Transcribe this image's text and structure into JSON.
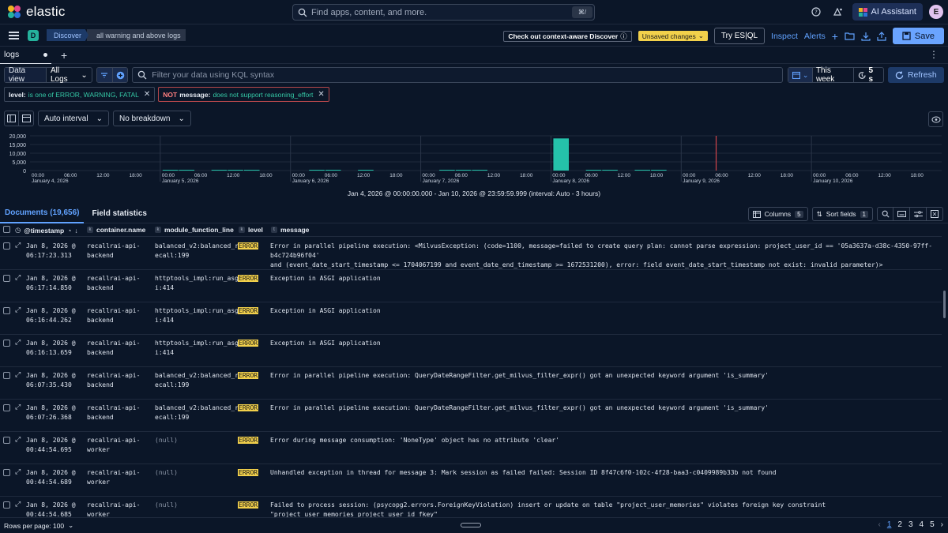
{
  "header": {
    "brand": "elastic",
    "search_placeholder": "Find apps, content, and more.",
    "search_shortcut": "⌘/",
    "ai_assistant_label": "AI Assistant",
    "avatar_initial": "E"
  },
  "navbar": {
    "space_initial": "D",
    "breadcrumb_app": "Discover",
    "breadcrumb_page": "all warning and above logs",
    "context_aware_label": "Check out context-aware Discover",
    "unsaved_label": "Unsaved changes",
    "esql_label": "Try ES|QL",
    "inspect_label": "Inspect",
    "alerts_label": "Alerts",
    "save_label": "Save"
  },
  "tabs": [
    {
      "label": "logs"
    }
  ],
  "query": {
    "data_view_label": "Data view",
    "data_view_value": "All Logs",
    "kql_placeholder": "Filter your data using KQL syntax",
    "date_range": "This week",
    "refresh_interval": "5 s",
    "refresh_label": "Refresh"
  },
  "filters": [
    {
      "key": "level:",
      "value": "is one of ERROR, WARNING, FATAL",
      "negated": false
    },
    {
      "not": "NOT",
      "key": "message:",
      "value": "does not support reasoning_effort",
      "negated": true
    }
  ],
  "chart_tools": {
    "interval_label": "Auto interval",
    "breakdown_label": "No breakdown"
  },
  "chart_data": {
    "type": "bar",
    "y_ticks": [
      "20,000",
      "15,000",
      "10,000",
      "5,000",
      "0"
    ],
    "ylim": [
      0,
      20000
    ],
    "days": [
      "January 4, 2026",
      "January 5, 2026",
      "January 6, 2026",
      "January 7, 2026",
      "January 8, 2026",
      "January 9, 2026",
      "January 10, 2026"
    ],
    "hour_ticks": [
      "00:00",
      "06:00",
      "12:00",
      "18:00"
    ],
    "bars": [
      {
        "bucket": "Jan 5, 00:00",
        "value": 150
      },
      {
        "bucket": "Jan 5, 03:00",
        "value": 180
      },
      {
        "bucket": "Jan 5, 09:00",
        "value": 120
      },
      {
        "bucket": "Jan 5, 12:00",
        "value": 80
      },
      {
        "bucket": "Jan 5, 15:00",
        "value": 100
      },
      {
        "bucket": "Jan 6, 03:00",
        "value": 200
      },
      {
        "bucket": "Jan 6, 06:00",
        "value": 100
      },
      {
        "bucket": "Jan 6, 12:00",
        "value": 120
      },
      {
        "bucket": "Jan 7, 03:00",
        "value": 150
      },
      {
        "bucket": "Jan 7, 06:00",
        "value": 200
      },
      {
        "bucket": "Jan 7, 09:00",
        "value": 80
      },
      {
        "bucket": "Jan 8, 00:00",
        "value": 18500
      },
      {
        "bucket": "Jan 8, 06:00",
        "value": 150
      },
      {
        "bucket": "Jan 8, 09:00",
        "value": 120
      },
      {
        "bucket": "Jan 8, 15:00",
        "value": 250
      },
      {
        "bucket": "Jan 8, 18:00",
        "value": 200
      }
    ],
    "now_marker": "Jan 9, 06:00",
    "range_label": "Jan 4, 2026 @ 00:00:00.000 - Jan 10, 2026 @ 23:59:59.999 (interval: Auto - 3 hours)"
  },
  "docs": {
    "documents_label": "Documents (19,656)",
    "field_stats_label": "Field statistics",
    "columns_label": "Columns",
    "columns_count": "5",
    "sort_label": "Sort fields",
    "sort_count": "1"
  },
  "table": {
    "columns": [
      "@timestamp",
      "container.name",
      "module_function_line",
      "level",
      "message"
    ],
    "rows": [
      {
        "date": "Jan 8, 2026 @",
        "time": "06:17:23.313",
        "container": [
          "recallrai-api-",
          "backend"
        ],
        "module": [
          "balanced_v2:balanced_r",
          "ecall:199"
        ],
        "level": "ERROR",
        "message": [
          "Error in parallel pipeline execution: <MilvusException: (code=1100, message=failed to create query plan: cannot parse expression: project_user_id == '05a3637a-d38c-4350-97ff-b4c724b96f04'",
          "and (event_date_start_timestamp <= 1704067199 and event_date_end_timestamp >= 1672531200), error: field event_date_start_timestamp not exist: invalid parameter)>"
        ]
      },
      {
        "date": "Jan 8, 2026 @",
        "time": "06:17:14.850",
        "container": [
          "recallrai-api-",
          "backend"
        ],
        "module": [
          "httptools_impl:run_asg",
          "i:414"
        ],
        "level": "ERROR",
        "message": [
          "Exception in ASGI application",
          ""
        ]
      },
      {
        "date": "Jan 8, 2026 @",
        "time": "06:16:44.262",
        "container": [
          "recallrai-api-",
          "backend"
        ],
        "module": [
          "httptools_impl:run_asg",
          "i:414"
        ],
        "level": "ERROR",
        "message": [
          "Exception in ASGI application",
          ""
        ]
      },
      {
        "date": "Jan 8, 2026 @",
        "time": "06:16:13.659",
        "container": [
          "recallrai-api-",
          "backend"
        ],
        "module": [
          "httptools_impl:run_asg",
          "i:414"
        ],
        "level": "ERROR",
        "message": [
          "Exception in ASGI application",
          ""
        ]
      },
      {
        "date": "Jan 8, 2026 @",
        "time": "06:07:35.430",
        "container": [
          "recallrai-api-",
          "backend"
        ],
        "module": [
          "balanced_v2:balanced_r",
          "ecall:199"
        ],
        "level": "ERROR",
        "message": [
          "Error in parallel pipeline execution: QueryDateRangeFilter.get_milvus_filter_expr() got an unexpected keyword argument 'is_summary'",
          ""
        ]
      },
      {
        "date": "Jan 8, 2026 @",
        "time": "06:07:26.368",
        "container": [
          "recallrai-api-",
          "backend"
        ],
        "module": [
          "balanced_v2:balanced_r",
          "ecall:199"
        ],
        "level": "ERROR",
        "message": [
          "Error in parallel pipeline execution: QueryDateRangeFilter.get_milvus_filter_expr() got an unexpected keyword argument 'is_summary'",
          ""
        ]
      },
      {
        "date": "Jan 8, 2026 @",
        "time": "00:44:54.695",
        "container": [
          "recallrai-api-",
          "worker"
        ],
        "module": [
          "(null)",
          ""
        ],
        "level": "ERROR",
        "message": [
          "Error during message consumption: 'NoneType' object has no attribute 'clear'",
          ""
        ]
      },
      {
        "date": "Jan 8, 2026 @",
        "time": "00:44:54.689",
        "container": [
          "recallrai-api-",
          "worker"
        ],
        "module": [
          "(null)",
          ""
        ],
        "level": "ERROR",
        "message": [
          "Unhandled exception in thread for message 3: Mark session as failed failed: Session ID 8f47c6f0-102c-4f28-baa3-c0409989b33b not found",
          ""
        ]
      },
      {
        "date": "Jan 8, 2026 @",
        "time": "00:44:54.685",
        "container": [
          "recallrai-api-",
          "worker"
        ],
        "module": [
          "(null)",
          ""
        ],
        "level": "ERROR",
        "message": [
          "Failed to process session: (psycopg2.errors.ForeignKeyViolation) insert or update on table \"project_user_memories\" violates foreign key constraint",
          "\"project_user_memories_project_user_id_fkey\""
        ]
      }
    ]
  },
  "footer": {
    "rows_per_page": "Rows per page: 100",
    "pages": [
      "1",
      "2",
      "3",
      "4",
      "5"
    ]
  }
}
